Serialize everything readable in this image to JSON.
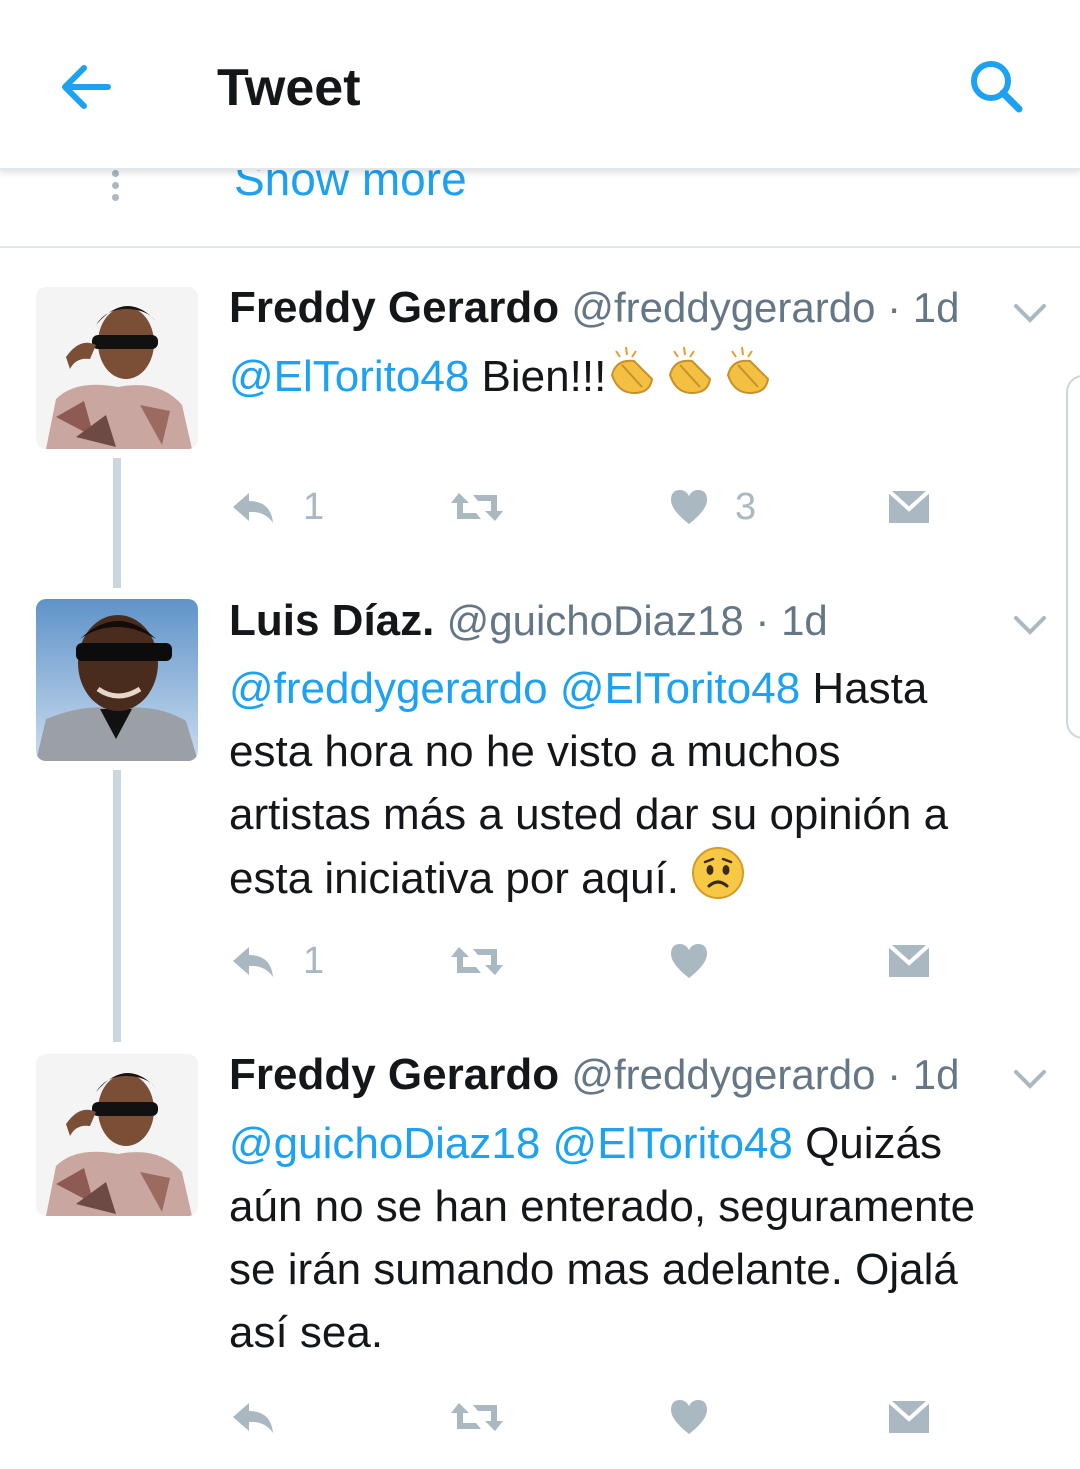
{
  "header": {
    "title": "Tweet"
  },
  "show_more": "Show more",
  "tweets": [
    {
      "name": "Freddy Gerardo",
      "handle": "@freddygerardo",
      "sep": " · ",
      "time": "1d",
      "mentions": [
        "@ElTorito48"
      ],
      "text": " Bien!!!",
      "emoji": "clapping-hands x3",
      "reply_count": "1",
      "retweet_count": "",
      "like_count": "3"
    },
    {
      "name": "Luis Díaz.",
      "handle": "@guichoDiaz18",
      "sep": " · ",
      "time": "1d",
      "mentions": [
        "@freddygerardo",
        "@ElTorito48"
      ],
      "text_a": " Hasta",
      "text_b": "esta hora no he visto a muchos",
      "text_c": "artistas más a usted dar su opinión a",
      "text_d": "esta iniciativa por aquí.",
      "emoji": "worried-face",
      "reply_count": "1",
      "retweet_count": "",
      "like_count": ""
    },
    {
      "name": "Freddy Gerardo",
      "handle": "@freddygerardo",
      "sep": " · ",
      "time": "1d",
      "mentions": [
        "@guichoDiaz18",
        "@ElTorito48"
      ],
      "text_a": " Quizás",
      "text_b": "aún no se han enterado, seguramente",
      "text_c": "se irán sumando mas adelante. Ojalá",
      "text_d": "así sea.",
      "reply_count": "",
      "retweet_count": "",
      "like_count": ""
    }
  ],
  "colors": {
    "link": "#1da1f2",
    "secondary": "#657786",
    "icon": "#aab8c2",
    "thread_line": "#ccd6dd"
  }
}
